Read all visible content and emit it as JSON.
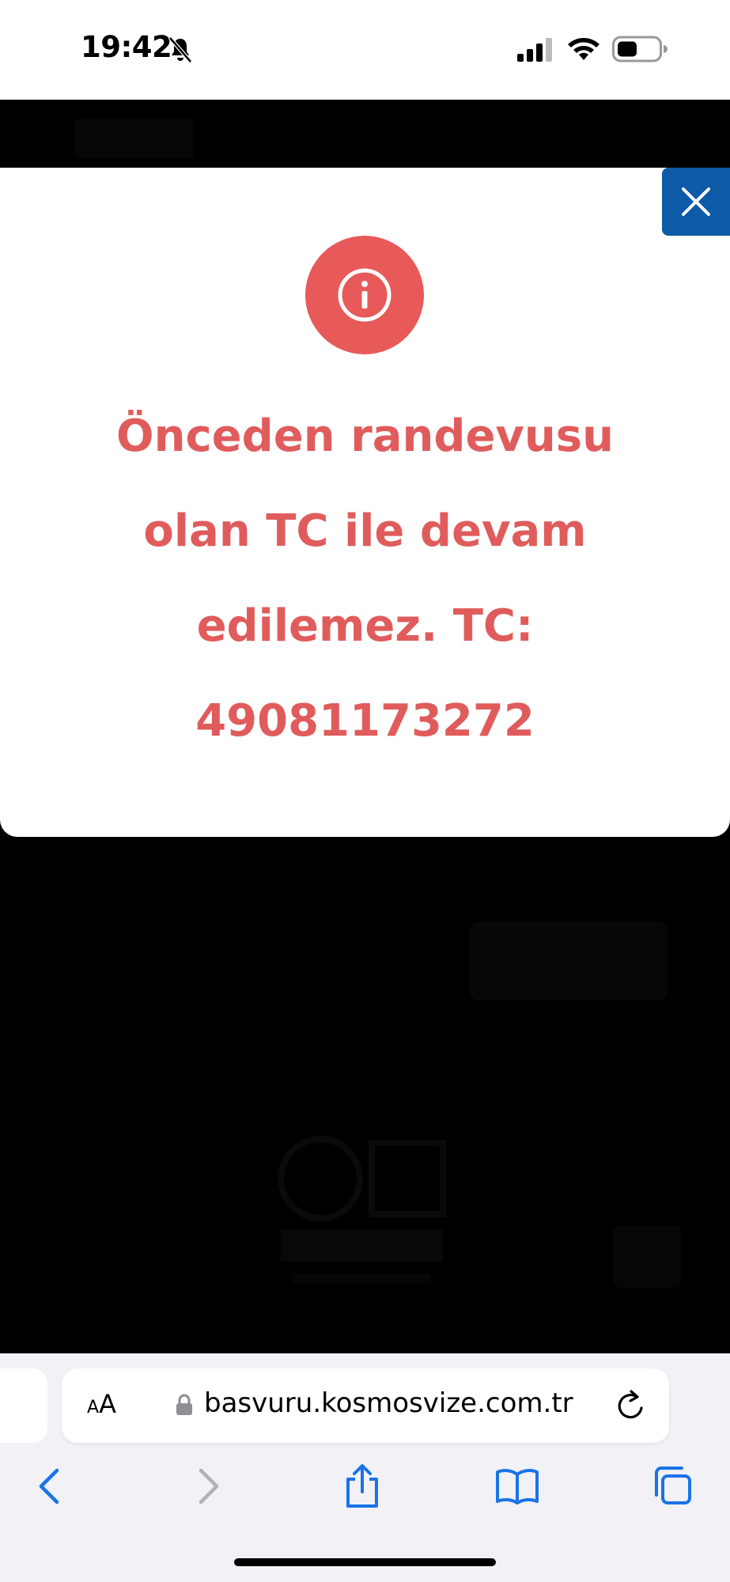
{
  "status_bar": {
    "time": "19:42",
    "icons": [
      "bell-slash-icon",
      "cellular-signal-icon",
      "wifi-icon",
      "battery-icon"
    ]
  },
  "modal": {
    "icon": "info-icon",
    "message_lines": [
      "Önceden randevusu",
      "olan TC ile devam",
      "edilemez. TC:",
      "49081173272"
    ],
    "colors": {
      "accent": "#e85a5a",
      "text": "#e05c5c",
      "close_bg": "#0d5aa7"
    }
  },
  "browser": {
    "aa_small": "A",
    "aa_big": "A",
    "url": "basvuru.kosmosvize.com.tr",
    "toolbar_icons": [
      "back-icon",
      "forward-icon",
      "share-icon",
      "bookmarks-icon",
      "tabs-icon"
    ]
  }
}
